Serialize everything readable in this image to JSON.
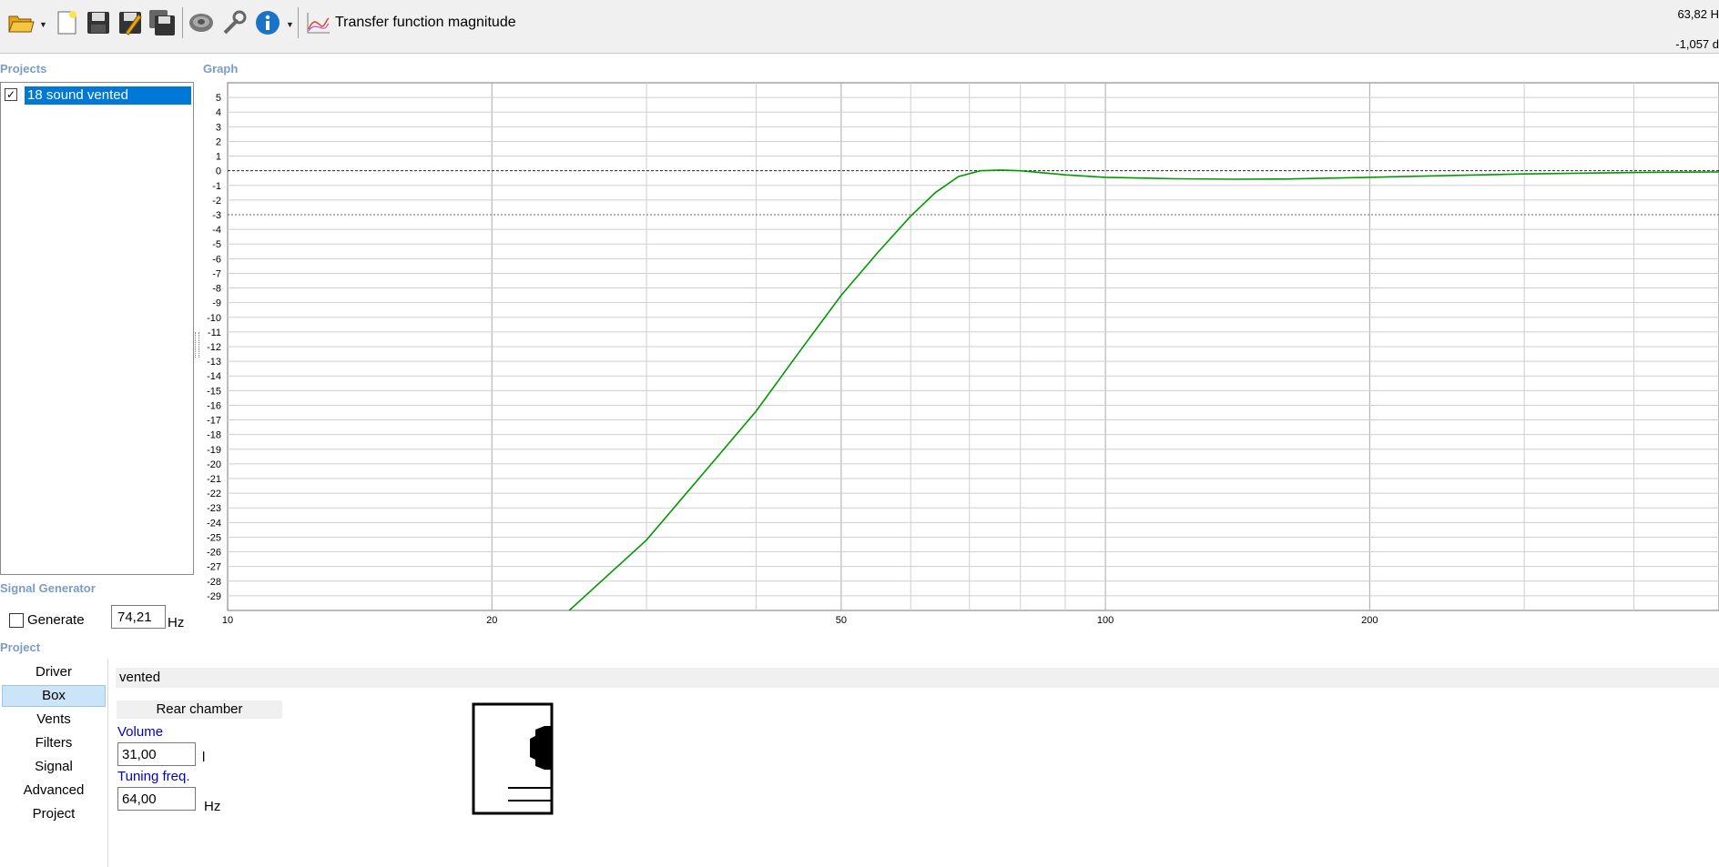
{
  "toolbar": {
    "view_title": "Transfer function magnitude",
    "icons": [
      "open-folder-icon",
      "new-file-icon",
      "save-icon",
      "save-as-icon",
      "save-all-icon",
      "driver-speaker-icon",
      "settings-wrench-icon",
      "info-icon",
      "chart-view-icon"
    ]
  },
  "readout": {
    "x_text": "63,82 H",
    "y_text": "-1,057 d"
  },
  "panels": {
    "projects_label": "Projects",
    "graph_label": "Graph",
    "signal_label": "Signal Generator",
    "project_label": "Project"
  },
  "projects": [
    {
      "name": "18 sound vented",
      "checked": true
    }
  ],
  "signal_generator": {
    "generate_label": "Generate",
    "frequency": "74,21",
    "unit": "Hz"
  },
  "tabs": [
    "Driver",
    "Box",
    "Vents",
    "Filters",
    "Signal",
    "Advanced",
    "Project"
  ],
  "active_tab": "Box",
  "box": {
    "mode": "vented",
    "rear_chamber_label": "Rear chamber",
    "volume_label": "Volume",
    "volume_value": "31,00",
    "volume_unit": "l",
    "tuning_label": "Tuning freq.",
    "tuning_value": "64,00",
    "tuning_unit": "Hz"
  },
  "chart_data": {
    "type": "line",
    "title": "Transfer function magnitude",
    "xlabel": "",
    "ylabel": "",
    "x_scale": "log",
    "xlim": [
      10,
      500
    ],
    "ylim": [
      -30,
      6
    ],
    "x_tick_labels": [
      "10",
      "20",
      "50",
      "100",
      "200"
    ],
    "y_tick_labels": [
      "5",
      "4",
      "3",
      "2",
      "1",
      "0",
      "-1",
      "-2",
      "-3",
      "-4",
      "-5",
      "-6",
      "-7",
      "-8",
      "-9",
      "-10",
      "-11",
      "-12",
      "-13",
      "-14",
      "-15",
      "-16",
      "-17",
      "-18",
      "-19",
      "-20",
      "-21",
      "-22",
      "-23",
      "-24",
      "-25",
      "-26",
      "-27",
      "-28",
      "-29"
    ],
    "reference_lines": [
      0,
      -3
    ],
    "grid": true,
    "series": [
      {
        "color": "#009900",
        "x": [
          24.5,
          30,
          35,
          40,
          45,
          50,
          55,
          60,
          64,
          68,
          72,
          76,
          80,
          90,
          100,
          120,
          140,
          160,
          200,
          250,
          300,
          400,
          500
        ],
        "y": [
          -30,
          -25.2,
          -20.5,
          -16.4,
          -12.2,
          -8.5,
          -5.6,
          -3.1,
          -1.5,
          -0.4,
          0,
          0.05,
          0,
          -0.28,
          -0.45,
          -0.55,
          -0.58,
          -0.57,
          -0.45,
          -0.32,
          -0.22,
          -0.12,
          -0.08
        ]
      }
    ]
  }
}
